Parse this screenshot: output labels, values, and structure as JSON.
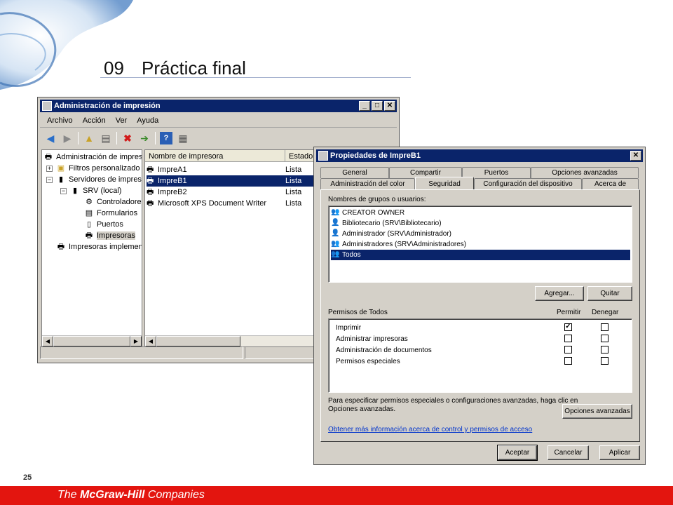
{
  "slide": {
    "number": "09",
    "title": "Práctica final",
    "page": "25",
    "footer_brand_pre": "The ",
    "footer_brand_bold": "McGraw-Hill",
    "footer_brand_post": " Companies"
  },
  "console": {
    "title": "Administración de impresión",
    "menu": [
      "Archivo",
      "Acción",
      "Ver",
      "Ayuda"
    ],
    "toolbar_icons": [
      "back-arrow-icon",
      "forward-arrow-icon",
      "up-folder-icon",
      "show-hide-tree-icon",
      "delete-icon",
      "export-icon",
      "help-icon",
      "properties-icon"
    ],
    "tree": [
      {
        "label": "Administración de impres",
        "icon": "printer-admin-icon"
      },
      {
        "label": "Filtros personalizado",
        "icon": "filter-icon"
      },
      {
        "label": "Servidores de impres",
        "icon": "server-icon"
      },
      {
        "label": "SRV (local)",
        "icon": "server-icon"
      },
      {
        "label": "Controladore",
        "icon": "driver-icon"
      },
      {
        "label": "Formularios",
        "icon": "forms-icon"
      },
      {
        "label": "Puertos",
        "icon": "ports-icon"
      },
      {
        "label": "Impresoras",
        "icon": "printer-icon"
      },
      {
        "label": "Impresoras implemen",
        "icon": "printer-icon"
      }
    ],
    "columns": [
      "Nombre de impresora",
      "Estado"
    ],
    "printers": [
      {
        "name": "ImpreA1",
        "status": "Lista"
      },
      {
        "name": "ImpreB1",
        "status": "Lista"
      },
      {
        "name": "ImpreB2",
        "status": "Lista"
      },
      {
        "name": "Microsoft XPS Document Writer",
        "status": "Lista"
      }
    ],
    "selected_printer_index": 1
  },
  "dialog": {
    "title": "Propiedades de ImpreB1",
    "tabs_row1": [
      "General",
      "Compartir",
      "Puertos",
      "Opciones avanzadas"
    ],
    "tabs_row2": [
      "Administración del color",
      "Seguridad",
      "Configuración del dispositivo",
      "Acerca de"
    ],
    "active_tab": "Seguridad",
    "groups_label": "Nombres de grupos o usuarios:",
    "users": [
      {
        "label": "CREATOR OWNER",
        "icon": "group-icon"
      },
      {
        "label": "Bibliotecario (SRV\\Bibliotecario)",
        "icon": "user-icon"
      },
      {
        "label": "Administrador (SRV\\Administrador)",
        "icon": "user-icon"
      },
      {
        "label": "Administradores (SRV\\Administradores)",
        "icon": "group-icon"
      },
      {
        "label": "Todos",
        "icon": "group-icon"
      }
    ],
    "selected_user_index": 4,
    "add_button": "Agregar...",
    "remove_button": "Quitar",
    "perm_label": "Permisos de Todos",
    "allow_header": "Permitir",
    "deny_header": "Denegar",
    "permissions": [
      {
        "label": "Imprimir",
        "allow": true,
        "deny": false
      },
      {
        "label": "Administrar impresoras",
        "allow": false,
        "deny": false
      },
      {
        "label": "Administración de documentos",
        "allow": false,
        "deny": false
      },
      {
        "label": "Permisos especiales",
        "allow": false,
        "deny": false
      }
    ],
    "special_text_1": "Para especificar permisos especiales o configuraciones avanzadas, haga clic en",
    "special_text_2": "Opciones avanzadas.",
    "advanced_button": "Opciones avanzadas",
    "help_link": "Obtener más información acerca de control y permisos de acceso",
    "ok_button": "Aceptar",
    "cancel_button": "Cancelar",
    "apply_button": "Aplicar"
  },
  "colors": {
    "titlebar": "#0a246a",
    "selection": "#0a246a",
    "footer": "#e3150f",
    "link": "#0033cc"
  }
}
